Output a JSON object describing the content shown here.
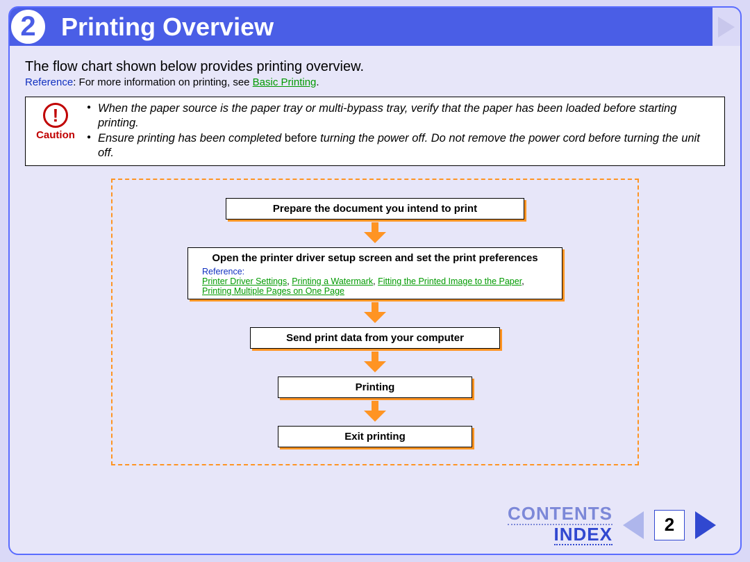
{
  "header": {
    "chapter_number": "2",
    "title": "Printing Overview"
  },
  "intro": "The flow chart shown below provides printing overview.",
  "reference": {
    "label": "Reference",
    "text": ": For more information on printing, see ",
    "link": "Basic Printing",
    "after": "."
  },
  "caution": {
    "label": "Caution",
    "items": [
      "When the paper source is the paper tray or multi-bypass tray, verify that the paper has been loaded before starting printing.",
      "Ensure printing has been completed |before| turning the power off. Do not remove the power cord before turning the unit off."
    ]
  },
  "flow": {
    "step1": "Prepare the document you intend to print",
    "step2": {
      "title": "Open the printer driver setup screen and set the print preferences",
      "ref_label": "Reference:",
      "links": [
        "Printer Driver Settings",
        "Printing a Watermark",
        "Fitting the Printed Image to the Paper",
        "Printing Multiple Pages on One Page"
      ]
    },
    "step3": "Send print data from your computer",
    "step4": "Printing",
    "step5": "Exit printing"
  },
  "footer": {
    "contents": "CONTENTS",
    "index": "INDEX",
    "page": "2"
  }
}
